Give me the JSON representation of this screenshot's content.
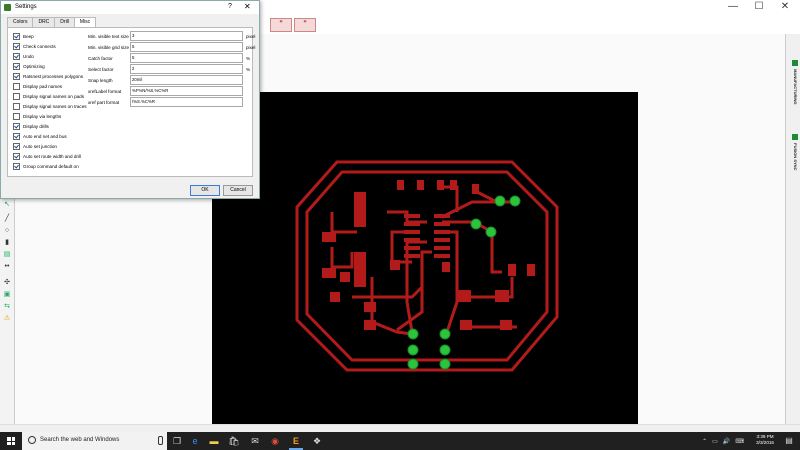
{
  "window": {
    "minimize": "—",
    "maximize": "☐",
    "close": "✕"
  },
  "toolbar": {
    "icons": [
      "ratsnest",
      "auto-route"
    ]
  },
  "right_panel": {
    "tabs": [
      "MANUFACTURING",
      "FUSION SYNC"
    ]
  },
  "dialog": {
    "title": "Settings",
    "help": "?",
    "close": "✕",
    "tabs": [
      "Colors",
      "DRC",
      "Drill",
      "Misc"
    ],
    "active_tab": "Misc",
    "checkboxes": [
      {
        "label": "Beep",
        "checked": true
      },
      {
        "label": "Check connects",
        "checked": true
      },
      {
        "label": "Undo",
        "checked": true
      },
      {
        "label": "Optimizing",
        "checked": true
      },
      {
        "label": "Ratsnest processes polygons",
        "checked": true
      },
      {
        "label": "Display pad names",
        "checked": false
      },
      {
        "label": "Display signal names on pads",
        "checked": false
      },
      {
        "label": "Display signal names on traces",
        "checked": false
      },
      {
        "label": "Display via lengths",
        "checked": false
      },
      {
        "label": "Display drills",
        "checked": true
      },
      {
        "label": "Auto end net and bus",
        "checked": true
      },
      {
        "label": "Auto set junction",
        "checked": true
      },
      {
        "label": "Auto set route width and drill",
        "checked": true
      },
      {
        "label": "Group command default on",
        "checked": true
      }
    ],
    "fields": [
      {
        "label": "Min. visible text size",
        "value": "3",
        "unit": "pixel"
      },
      {
        "label": "Min. visible grid size",
        "value": "5",
        "unit": "pixel"
      },
      {
        "label": "Catch factor",
        "value": "5",
        "unit": "%"
      },
      {
        "label": "Select factor",
        "value": "2",
        "unit": "%"
      },
      {
        "label": "Snap length",
        "value": "20mil",
        "unit": ""
      },
      {
        "label": "xrefLabel format",
        "value": "%F%N/%S.%C%R",
        "unit": ""
      },
      {
        "label": "xref part format",
        "value": "/%S.%C%R",
        "unit": ""
      }
    ],
    "ok": "OK",
    "cancel": "Cancel"
  },
  "taskbar": {
    "search_placeholder": "Search the web and Windows",
    "time": "3:39 PM",
    "date": "3/3/2016",
    "apps": [
      "task-view",
      "edge",
      "file-explorer",
      "store",
      "mail",
      "chrome",
      "eagle",
      "another-app"
    ]
  },
  "colors": {
    "trace": "#b31b1b",
    "via": "#2cc43c",
    "board": "#000000",
    "taskbar": "#202020"
  }
}
